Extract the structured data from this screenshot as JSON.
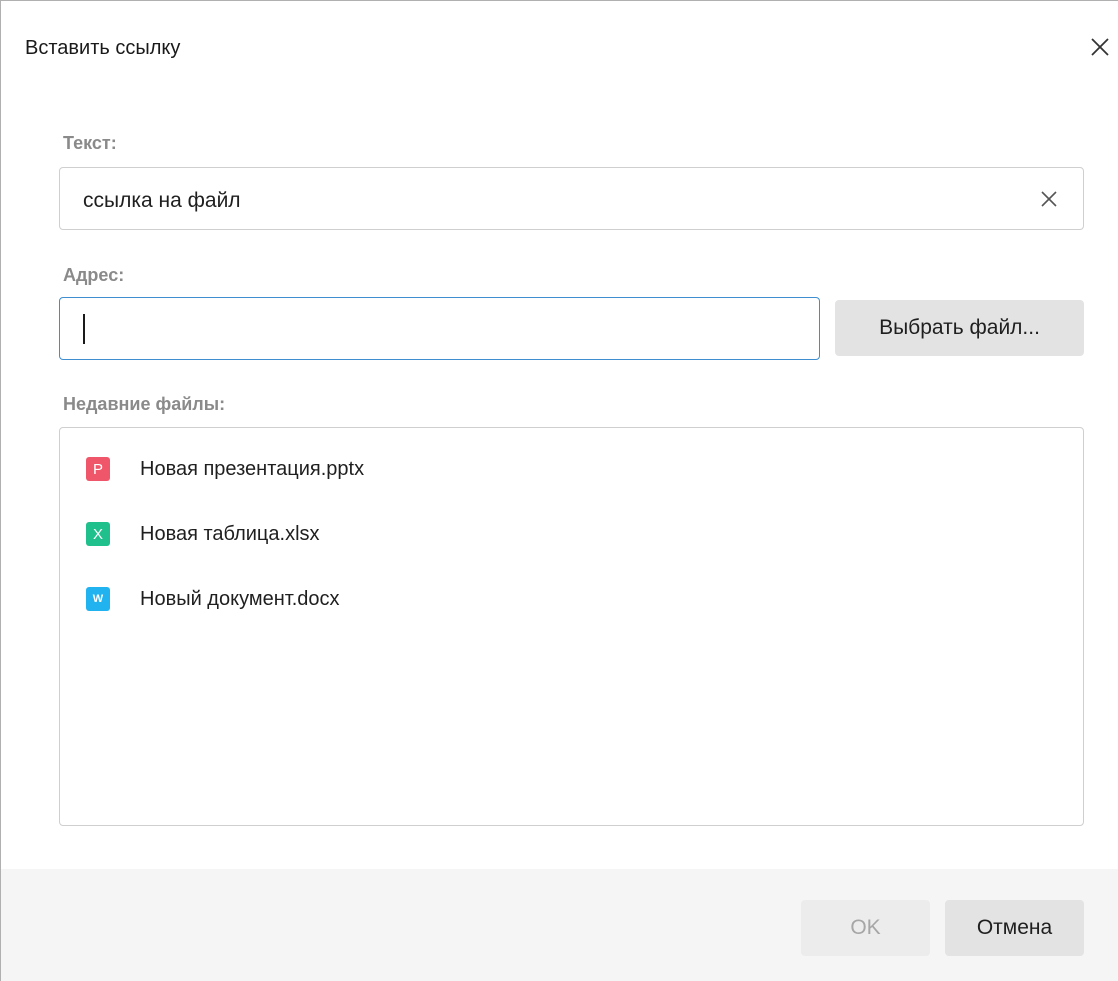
{
  "dialog": {
    "title": "Вставить ссылку",
    "close_icon": "close-icon"
  },
  "text_field": {
    "label": "Текст:",
    "value": "ссылка на файл",
    "clear_icon": "clear-icon"
  },
  "address_field": {
    "label": "Адрес:",
    "value": "",
    "focused": true,
    "focus_color": "#3e8ed0"
  },
  "choose_file_button": {
    "label": "Выбрать файл..."
  },
  "recent_files": {
    "label": "Недавние файлы:",
    "items": [
      {
        "name": "Новая презентация.pptx",
        "icon_letter": "P",
        "icon": "presentation-file-icon",
        "color": "#f0566a"
      },
      {
        "name": "Новая таблица.xlsx",
        "icon_letter": "X",
        "icon": "spreadsheet-file-icon",
        "color": "#1fc08c"
      },
      {
        "name": "Новый документ.docx",
        "icon_letter": "W",
        "icon": "document-file-icon",
        "color": "#21b3f0"
      }
    ]
  },
  "footer": {
    "ok_label": "OK",
    "ok_disabled": true,
    "cancel_label": "Отмена"
  }
}
